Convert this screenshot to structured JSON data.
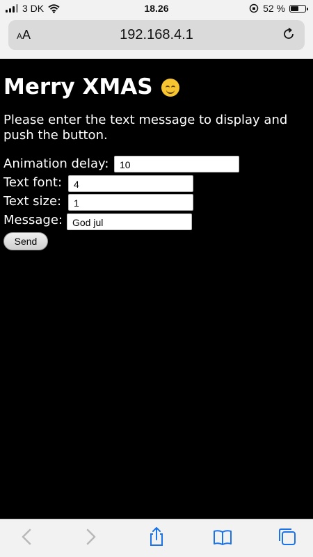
{
  "status_bar": {
    "carrier": "3 DK",
    "time": "18.26",
    "battery_percent": "52 %",
    "battery_level": 0.52
  },
  "browser": {
    "text_size_button": "AA",
    "url": "192.168.4.1"
  },
  "page": {
    "title": "Merry XMAS",
    "title_emoji": "smiling-face-icon",
    "intro": "Please enter the text message to display and push the button.",
    "fields": {
      "animation_delay": {
        "label": "Animation delay:",
        "value": "10"
      },
      "text_font": {
        "label": "Text font:",
        "value": "4"
      },
      "text_size": {
        "label": "Text size:",
        "value": "1"
      },
      "message": {
        "label": "Message:",
        "value": "God jul"
      }
    },
    "send_label": "Send"
  },
  "toolbar": {
    "icons": [
      "back-arrow-icon",
      "forward-arrow-icon",
      "share-icon",
      "bookmarks-icon",
      "tabs-icon"
    ],
    "accent_color": "#1a73e8",
    "disabled_color": "#b8b8b8"
  }
}
